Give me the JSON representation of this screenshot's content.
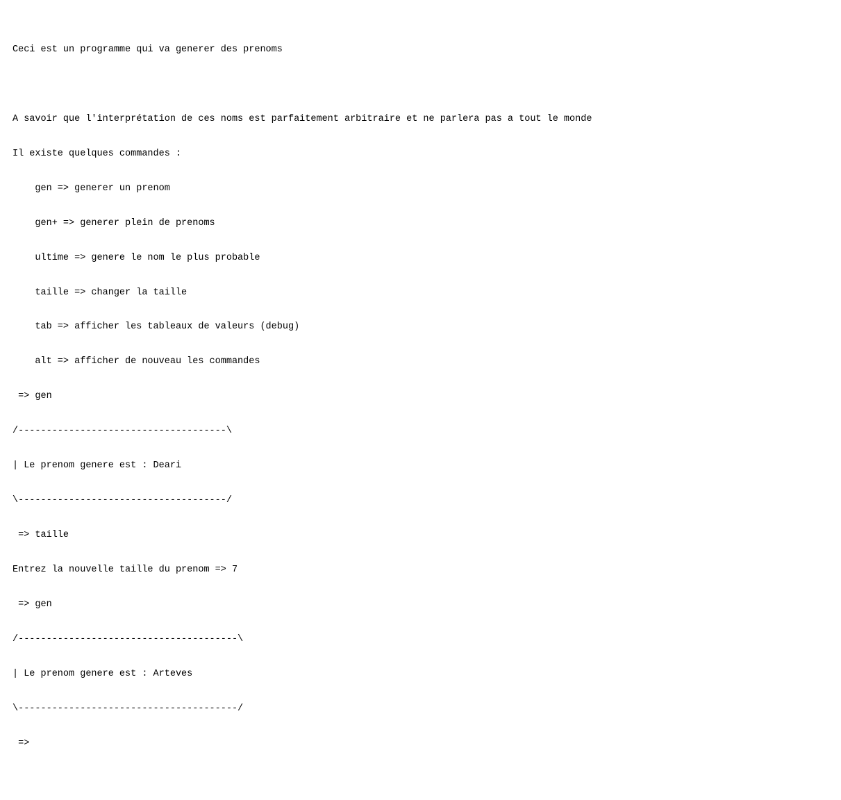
{
  "intro": {
    "title": "Ceci est un programme qui va generer des prenoms",
    "blank": "",
    "note": "A savoir que l'interprétation de ces noms est parfaitement arbitraire et ne parlera pas a tout le monde",
    "cmds_header": "Il existe quelques commandes :",
    "cmd_gen": "    gen => generer un prenom",
    "cmd_genp": "    gen+ => generer plein de prenoms",
    "cmd_ultime": "    ultime => genere le nom le plus probable",
    "cmd_taille": "    taille => changer la taille",
    "cmd_tab": "    tab => afficher les tableaux de valeurs (debug)",
    "cmd_alt": "    alt => afficher de nouveau les commandes"
  },
  "session": {
    "prompt1": " => gen",
    "box1_top": "/-------------------------------------\\",
    "box1_mid": "| Le prenom genere est : Deari",
    "box1_bot": "\\-------------------------------------/",
    "prompt2": " => taille",
    "taille_line": "Entrez la nouvelle taille du prenom => 7",
    "prompt3": " => gen",
    "box2_top": "/---------------------------------------\\",
    "box2_mid": "| Le prenom genere est : Arteves",
    "box2_bot": "\\---------------------------------------/",
    "prompt4": " =>"
  }
}
